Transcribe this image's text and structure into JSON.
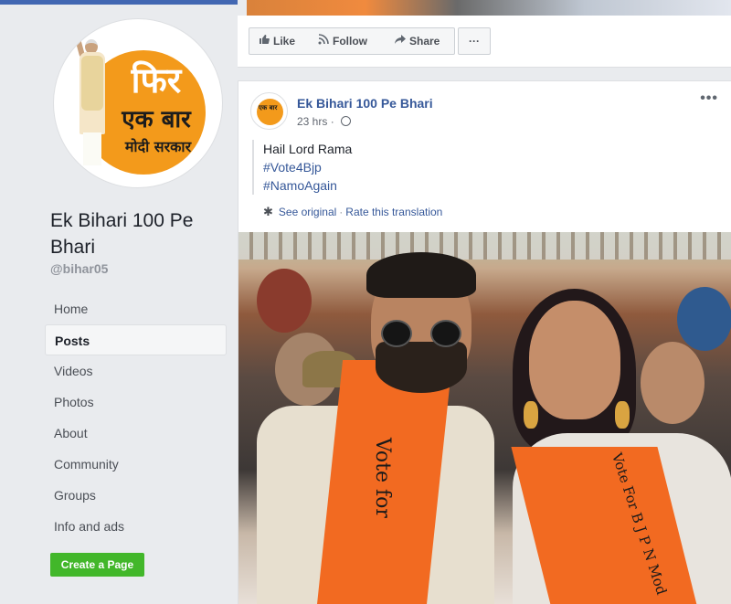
{
  "sidebar": {
    "page_name": "Ek Bihari 100 Pe Bhari",
    "handle": "@bihar05",
    "logo_text": {
      "line1": "फिर",
      "line2": "एक बार",
      "line3": "मोदी सरकार"
    },
    "nav": [
      {
        "label": "Home",
        "active": false
      },
      {
        "label": "Posts",
        "active": true
      },
      {
        "label": "Videos",
        "active": false
      },
      {
        "label": "Photos",
        "active": false
      },
      {
        "label": "About",
        "active": false
      },
      {
        "label": "Community",
        "active": false
      },
      {
        "label": "Groups",
        "active": false
      },
      {
        "label": "Info and ads",
        "active": false
      }
    ],
    "create_page_label": "Create a Page"
  },
  "actions": {
    "like": "Like",
    "follow": "Follow",
    "share": "Share",
    "more": "···"
  },
  "post": {
    "author": "Ek Bihari 100 Pe Bhari",
    "time": "23 hrs",
    "options": "•••",
    "text_lines": [
      "Hail Lord Rama"
    ],
    "hashtags": [
      "#Vote4Bjp",
      "#NamoAgain"
    ],
    "see_original": "See original",
    "rate_translation": "Rate this translation",
    "photo": {
      "shawl_text_left": "Vote for",
      "shawl_text_right": "Vote For B J P N Mod"
    }
  },
  "colors": {
    "facebook_blue": "#4267b2",
    "link_blue": "#365899",
    "create_green": "#42b72a",
    "saffron": "#f26a21",
    "logo_orange": "#f39a1b"
  },
  "icons": [
    "thumbs-up-icon",
    "rss-follow-icon",
    "share-arrow-icon",
    "more-dots-icon",
    "globe-icon",
    "gear-icon"
  ]
}
